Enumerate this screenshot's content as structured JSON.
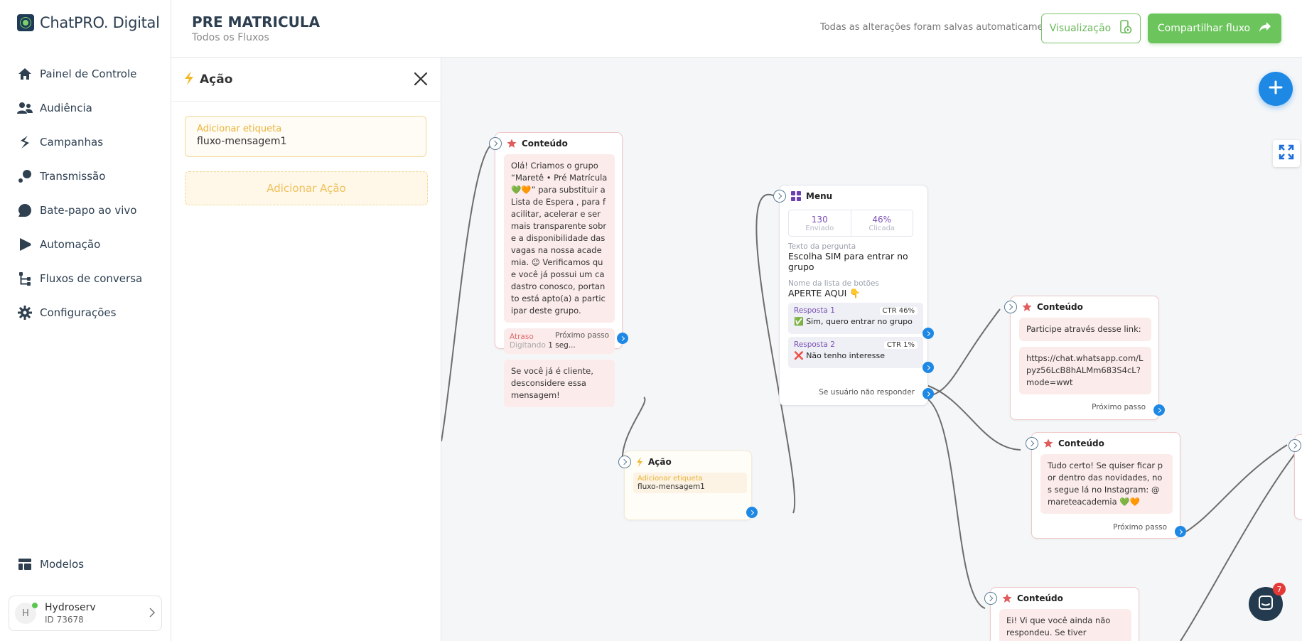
{
  "brand": {
    "name": "ChatPRO. Digital"
  },
  "sidebar": {
    "items": [
      {
        "label": "Painel de Controle",
        "icon": "home-icon"
      },
      {
        "label": "Audiência",
        "icon": "users-icon"
      },
      {
        "label": "Campanhas",
        "icon": "bolt-icon"
      },
      {
        "label": "Transmissão",
        "icon": "broadcast-icon"
      },
      {
        "label": "Bate-papo ao vivo",
        "icon": "chat-bubble-icon"
      },
      {
        "label": "Automação",
        "icon": "automation-icon"
      },
      {
        "label": "Fluxos de conversa",
        "icon": "flow-icon"
      },
      {
        "label": "Configurações",
        "icon": "gear-icon"
      }
    ],
    "models_label": "Modelos",
    "account": {
      "initial": "H",
      "name": "Hydroserv",
      "id": "ID 73678"
    }
  },
  "header": {
    "title": "PRE MATRICULA",
    "breadcrumb": "Todos os Fluxos",
    "saved_status": "Todas as alterações foram salvas automaticamente",
    "preview_label": "Visualização",
    "share_label": "Compartilhar fluxo"
  },
  "panel": {
    "title": "Ação",
    "tag_label": "Adicionar etiqueta",
    "tag_value": "fluxo-mensagem1",
    "add_action_label": "Adicionar Ação"
  },
  "colors": {
    "accent_green": "#6cc45c",
    "accent_blue": "#1e88e5",
    "action_yellow": "#eab43a",
    "content_red": "#e05b5b"
  },
  "canvas": {
    "chat_badge": "7",
    "nodes": {
      "content1": {
        "title": "Conteúdo",
        "message": "Olá! Criamos o grupo “Maretê • Pré Matrícula 💚🧡” para substituir a Lista de Espera , para facilitar, acelerar e ser mais transparente sobre a disponibilidade das vagas na nossa academia. 😉 Verificamos que você já possui um cadastro conosco, portanto está apto(a) a participar deste grupo.",
        "delay_label": "Atraso",
        "delay_typing": "Digitando",
        "delay_value": "1 seg...",
        "message2": "Se você já é cliente, desconsidere essa mensagem!",
        "next": "Próximo passo"
      },
      "action1": {
        "title": "Ação",
        "tag_label": "Adicionar etiqueta",
        "tag_value": "fluxo-mensagem1"
      },
      "menu1": {
        "title": "Menu",
        "sent_value": "130",
        "sent_label": "Enviado",
        "clicked_value": "46%",
        "clicked_label": "Clicada",
        "question_label": "Texto da pergunta",
        "question_value": "Escolha SIM para entrar no grupo",
        "list_label": "Nome da lista de botões",
        "list_value": "APERTE AQUI 👇",
        "responses": [
          {
            "title": "Resposta 1",
            "ctr": "CTR 46%",
            "value": "✅ Sim, quero entrar no grupo"
          },
          {
            "title": "Resposta 2",
            "ctr": "CTR 1%",
            "value": "❌ Não tenho interesse"
          }
        ],
        "no_reply": "Se usuário não responder"
      },
      "content2": {
        "title": "Conteúdo",
        "message": "Participe através desse link:",
        "link": "https://chat.whatsapp.com/Lpyz56LcB8hALMm683S4cL?mode=wwt",
        "next": "Próximo passo"
      },
      "content3": {
        "title": "Conteúdo",
        "message": "Tudo certo! Se quiser ficar por dentro das novidades, nos segue lá no Instagram: @mareteacademia 💚🧡",
        "next": "Próximo passo"
      },
      "content4": {
        "title": "Conteúdo",
        "message": "Ei! Vi que você ainda não respondeu. Se tiver interesse em e"
      }
    }
  }
}
